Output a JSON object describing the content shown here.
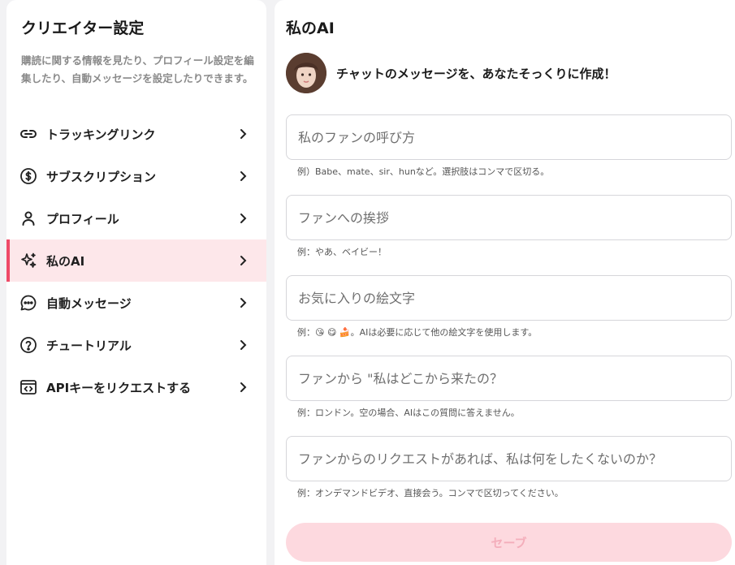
{
  "sidebar": {
    "title": "クリエイター設定",
    "description": "購読に関する情報を見たり、プロフィール設定を編集したり、自動メッセージを設定したりできます。",
    "items": [
      {
        "label": "トラッキングリンク",
        "icon": "link-icon"
      },
      {
        "label": "サブスクリプション",
        "icon": "dollar-icon"
      },
      {
        "label": "プロフィール",
        "icon": "user-icon"
      },
      {
        "label": "私のAI",
        "icon": "sparkles-icon",
        "active": true
      },
      {
        "label": "自動メッセージ",
        "icon": "chat-bubble-icon"
      },
      {
        "label": "チュートリアル",
        "icon": "question-icon"
      },
      {
        "label": "APIキーをリクエストする",
        "icon": "code-window-icon"
      }
    ]
  },
  "main": {
    "title": "私のAI",
    "intro": "チャットのメッセージを、あなたそっくりに作成！",
    "fields": [
      {
        "placeholder": "私のファンの呼び方",
        "hint": "例）Babe、mate、sir、hunなど。選択肢はコンマで区切る。"
      },
      {
        "placeholder": "ファンへの挨拶",
        "hint": "例：やあ、ベイビー！"
      },
      {
        "placeholder": "お気に入りの絵文字",
        "hint": "例：😘 😋 🍰。AIは必要に応じて他の絵文字を使用します。"
      },
      {
        "placeholder": "ファンから \"私はどこから来たの？",
        "hint": "例：ロンドン。空の場合、AIはこの質問に答えません。"
      },
      {
        "placeholder": "ファンからのリクエストがあれば、私は何をしたくないのか？",
        "hint": "例：オンデマンドビデオ、直接会う。コンマで区切ってください。"
      }
    ],
    "save_label": "セーブ"
  },
  "colors": {
    "accent": "#ee4b68",
    "active_bg": "#fde7ea",
    "save_bg": "#fdd9df",
    "save_text": "#f4aebb"
  }
}
